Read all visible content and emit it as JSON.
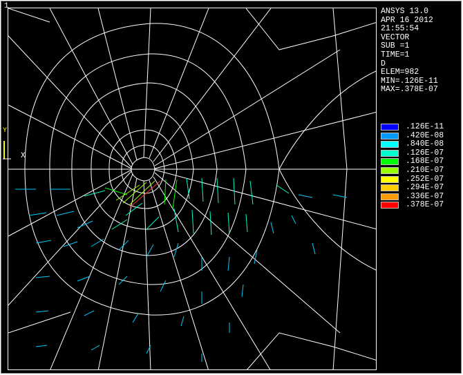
{
  "window": {
    "number": "1"
  },
  "info": {
    "lines": [
      "ANSYS 13.0",
      "APR 16 2012",
      "21:55:54",
      "VECTOR",
      "SUB =1",
      "TIME=1",
      "D",
      "ELEM=982",
      "MIN=.126E-11",
      "MAX=.378E-07"
    ]
  },
  "legend": {
    "entries": [
      {
        "label": ".126E-11",
        "color": "#0000ff"
      },
      {
        "label": ".420E-08",
        "color": "#0099ff"
      },
      {
        "label": ".840E-08",
        "color": "#00ffff"
      },
      {
        "label": ".126E-07",
        "color": "#00ffcc"
      },
      {
        "label": ".168E-07",
        "color": "#00ff00"
      },
      {
        "label": ".210E-07",
        "color": "#99ff00"
      },
      {
        "label": ".252E-07",
        "color": "#ffff00"
      },
      {
        "label": ".294E-07",
        "color": "#ffcc00"
      },
      {
        "label": ".336E-07",
        "color": "#ff9900"
      },
      {
        "label": ".378E-07",
        "color": "#ff0000"
      }
    ]
  },
  "triad": {
    "x_label": "X",
    "y_label": "Y"
  },
  "colors": {
    "background": "#000000",
    "mesh": "#ffffff",
    "axis_yellow": "#ffff00"
  }
}
